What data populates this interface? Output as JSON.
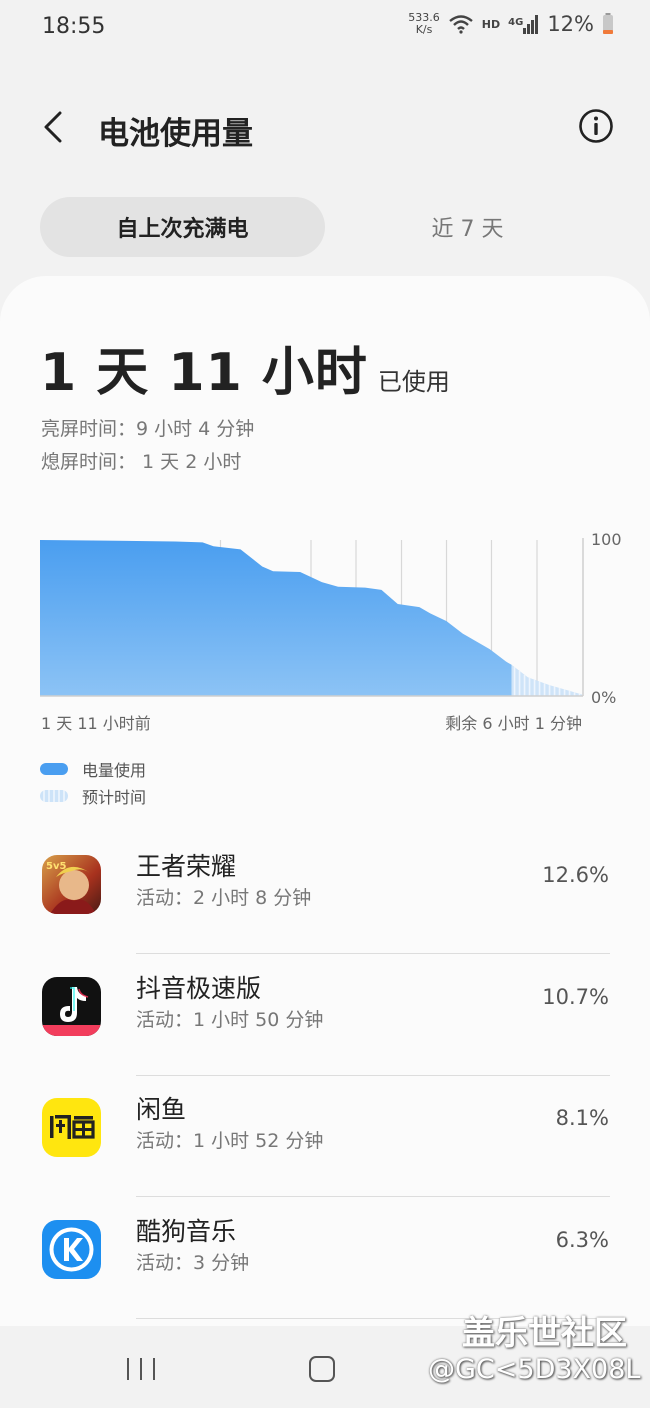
{
  "status_bar": {
    "time": "18:55",
    "net_speed_value": "533.6",
    "net_speed_unit": "K/s",
    "hd": "HD",
    "network": "4G",
    "battery": "12%"
  },
  "header": {
    "title": "电池使用量"
  },
  "tabs": [
    {
      "label": "自上次充满电",
      "active": true
    },
    {
      "label": "近 7 天",
      "active": false
    }
  ],
  "summary": {
    "duration": "1 天 11 小时",
    "used_label": "已使用",
    "screen_on": "亮屏时间：9 小时 4 分钟",
    "screen_off": "熄屏时间： 1 天 2 小时"
  },
  "chart_data": {
    "type": "area",
    "y_top_label": "100",
    "y_bottom_label": "0%",
    "x_start_label": "1 天 11 小时前",
    "x_end_label": "剩余 6 小时 1 分钟",
    "ylim": [
      0,
      100
    ],
    "usage_series": [
      [
        0,
        100
      ],
      [
        0.12,
        99.6
      ],
      [
        0.25,
        99
      ],
      [
        0.3,
        98.5
      ],
      [
        0.32,
        96
      ],
      [
        0.37,
        94
      ],
      [
        0.41,
        83
      ],
      [
        0.43,
        80
      ],
      [
        0.48,
        79.5
      ],
      [
        0.52,
        73
      ],
      [
        0.55,
        70
      ],
      [
        0.6,
        69.5
      ],
      [
        0.63,
        68
      ],
      [
        0.66,
        59
      ],
      [
        0.7,
        57
      ],
      [
        0.72,
        53
      ],
      [
        0.75,
        48
      ],
      [
        0.78,
        40
      ],
      [
        0.83,
        30
      ],
      [
        0.86,
        22
      ],
      [
        0.87,
        20
      ]
    ],
    "forecast_series": [
      [
        0.87,
        20
      ],
      [
        0.9,
        12
      ],
      [
        0.94,
        7
      ],
      [
        0.97,
        4
      ],
      [
        1.0,
        1
      ]
    ],
    "grid_x": [
      0.333,
      0.5,
      0.583,
      0.667,
      0.75,
      0.833,
      0.917
    ],
    "colors": {
      "usage": "#4a9ef0",
      "forecast": "#cde3f8",
      "grid": "#d8d8d8"
    },
    "legend": [
      {
        "label": "电量使用",
        "color": "#4a9ef0"
      },
      {
        "label": "预计时间",
        "color": "#cde3f8"
      }
    ]
  },
  "apps": [
    {
      "name": "王者荣耀",
      "activity": "活动：2 小时 8 分钟",
      "percent": "12.6%",
      "icon": "honor-of-kings-icon"
    },
    {
      "name": "抖音极速版",
      "activity": "活动：1 小时 50 分钟",
      "percent": "10.7%",
      "icon": "douyin-lite-icon"
    },
    {
      "name": "闲鱼",
      "activity": "活动：1 小时 52 分钟",
      "percent": "8.1%",
      "icon": "xianyu-icon"
    },
    {
      "name": "酷狗音乐",
      "activity": "活动：3 分钟",
      "percent": "6.3%",
      "icon": "kugou-icon"
    }
  ],
  "watermark": {
    "line1": "盖乐世社区",
    "line2": "@GC<5D3X08L"
  }
}
